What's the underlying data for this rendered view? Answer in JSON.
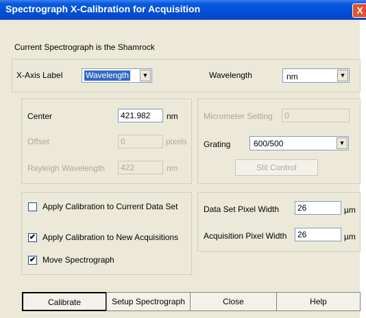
{
  "window": {
    "title": "Spectrograph X-Calibration for Acquisition",
    "close_glyph": "X"
  },
  "info": "Current Spectrograph is the Shamrock",
  "axis": {
    "x_axis_label": "X-Axis Label",
    "x_axis_value": "Wavelength",
    "wavelength_label": "Wavelength",
    "wavelength_unit": "nm"
  },
  "calibration": {
    "center_label": "Center",
    "center_value": "421.982",
    "center_unit": "nm",
    "offset_label": "Offset",
    "offset_value": "0",
    "offset_unit": "pixels",
    "rayleigh_label": "Rayleigh Wavelength",
    "rayleigh_value": "422",
    "rayleigh_unit": "nm"
  },
  "spectrograph": {
    "micrometer_label": "Micrometer Setting",
    "micrometer_value": "0",
    "grating_label": "Grating",
    "grating_value": "600/500",
    "slit_control_label": "Slit Control"
  },
  "options": [
    {
      "label": "Apply Calibration to Current Data Set",
      "checked": false
    },
    {
      "label": "Apply Calibration to New Acquisitions",
      "checked": true
    },
    {
      "label": "Move Spectrograph",
      "checked": true
    }
  ],
  "pixel_width": {
    "data_set_label": "Data Set Pixel Width",
    "data_set_value": "26",
    "data_set_unit": "µm",
    "acquisition_label": "Acquisition Pixel Width",
    "acquisition_value": "26",
    "acquisition_unit": "µm"
  },
  "buttons": {
    "calibrate": "Calibrate",
    "setup": "Setup Spectrograph",
    "close": "Close",
    "help": "Help"
  },
  "check_glyph": "✔",
  "dropdown_glyph": "▼",
  "colors": {
    "titlebar": "#0050d8",
    "dialog": "#ece9d8",
    "selection": "#316ac5",
    "close_button": "#e0532e"
  }
}
